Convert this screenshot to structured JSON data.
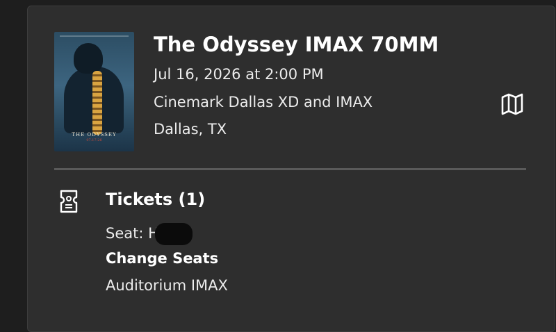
{
  "event": {
    "title": "The Odyssey IMAX 70MM",
    "datetime": "Jul 16, 2026 at 2:00 PM",
    "theater": "Cinemark Dallas XD and IMAX",
    "location": "Dallas, TX"
  },
  "poster": {
    "title": "THE ODYSSEY",
    "date": "07.17.26"
  },
  "tickets": {
    "heading": "Tickets (1)",
    "seat_label": "Seat: H",
    "change_seats_label": "Change Seats",
    "auditorium": "Auditorium IMAX"
  },
  "icons": {
    "map": "map-icon",
    "ticket": "ticket-icon"
  }
}
